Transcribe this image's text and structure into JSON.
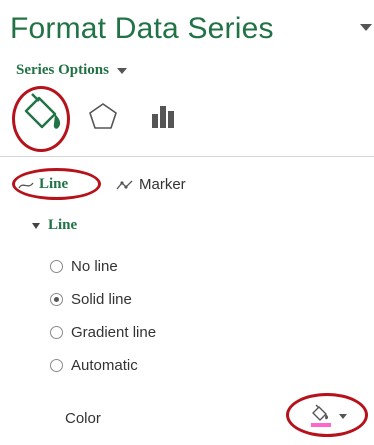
{
  "pane": {
    "title": "Format Data Series",
    "series_options_label": "Series Options",
    "icons": {
      "fill_line": "paint-bucket-icon",
      "effects": "pentagon-icon",
      "series_options": "bar-chart-icon"
    }
  },
  "subtabs": {
    "line_label": "Line",
    "marker_label": "Marker"
  },
  "section": {
    "title": "Line"
  },
  "line_options": [
    {
      "label": "No line",
      "selected": false
    },
    {
      "label": "Solid line",
      "selected": true
    },
    {
      "label": "Gradient line",
      "selected": false
    },
    {
      "label": "Automatic",
      "selected": false
    }
  ],
  "color": {
    "label": "Color",
    "swatch": "#ff66cc"
  },
  "theme": {
    "accent": "#217346",
    "highlight_ring": "#b5121b"
  }
}
